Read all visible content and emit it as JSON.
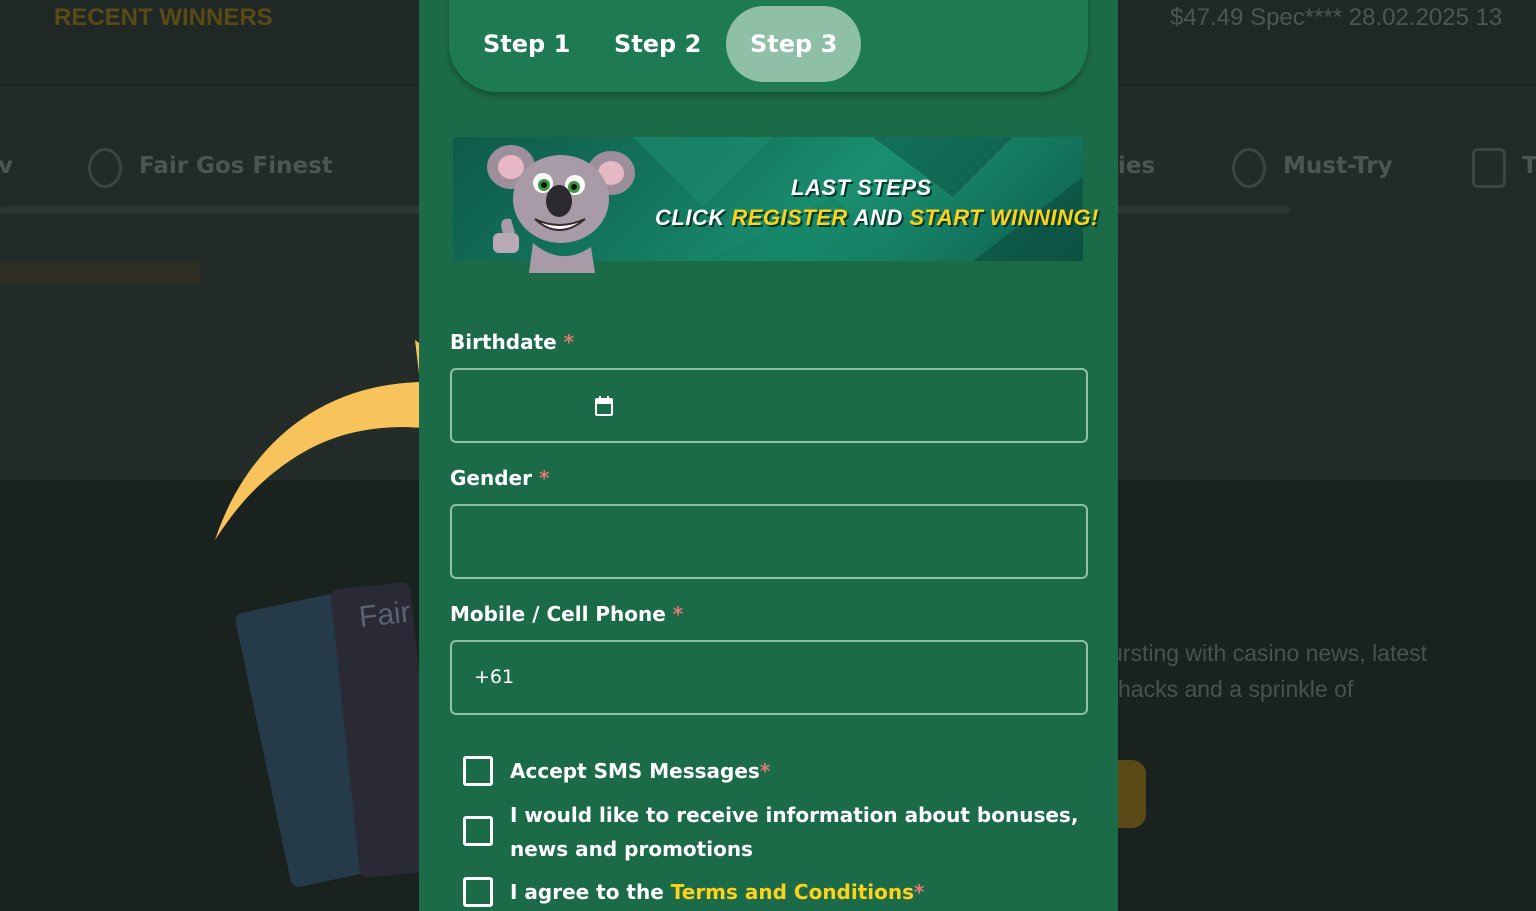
{
  "background": {
    "recent_winners": "RECENT WINNERS",
    "ticker": "$47.49 Spec**** 28.02.2025 13",
    "nav_items": [
      "v",
      "Fair Gos Finest",
      "ies",
      "Must-Try",
      "T"
    ],
    "blurb_line1": "ursting with casino news, latest",
    "blurb_line2": "hacks and a sprinkle of",
    "book_text": "Fair"
  },
  "stepper": {
    "steps": [
      {
        "label": "Step 1",
        "active": false
      },
      {
        "label": "Step 2",
        "active": false
      },
      {
        "label": "Step 3",
        "active": true
      }
    ]
  },
  "banner": {
    "line1": "LAST STEPS",
    "line2_prefix": "CLICK ",
    "line2_register": "REGISTER",
    "line2_and": " AND ",
    "line2_start": "START WINNING!"
  },
  "form": {
    "birthdate": {
      "label": "Birthdate",
      "required": "*",
      "value": "",
      "icon": "calendar-icon"
    },
    "gender": {
      "label": "Gender",
      "required": "*",
      "value": ""
    },
    "phone": {
      "label": "Mobile / Cell Phone",
      "required": "*",
      "value": "+61"
    }
  },
  "checkboxes": {
    "sms": {
      "label": "Accept SMS Messages",
      "required": "*",
      "checked": false
    },
    "bonus": {
      "line1": "I would like to receive information about bonuses,",
      "line2": "news and promotions",
      "checked": false
    },
    "terms": {
      "prefix": "I agree to the ",
      "link": "Terms and Conditions",
      "required": "*",
      "checked": false
    }
  },
  "colors": {
    "modal_bg": "#1c6b48",
    "accent_yellow": "#ffd21a",
    "required_red": "#e27a72",
    "arrow": "#f9c35c"
  }
}
